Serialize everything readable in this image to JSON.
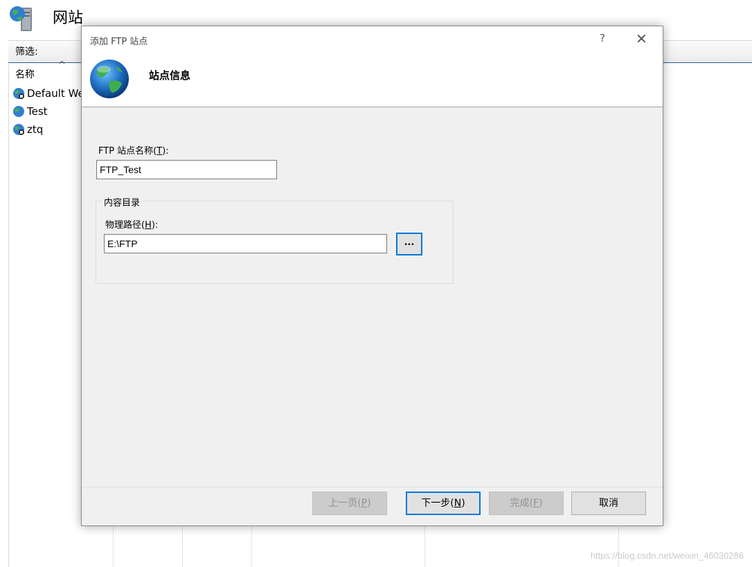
{
  "background": {
    "title": "网站",
    "filter_label": "筛选:",
    "column_name": "名称",
    "sites": [
      {
        "name": "Default We"
      },
      {
        "name": "Test"
      },
      {
        "name": "ztq"
      }
    ],
    "watermark": "https://blog.csdn.net/weixin_46030286"
  },
  "dialog": {
    "title": "添加 FTP 站点",
    "help_glyph": "?",
    "close_glyph": "✕",
    "banner_title": "站点信息",
    "site_name_label": "FTP 站点名称(",
    "site_name_accel": "T",
    "site_name_tail": "):",
    "site_name_value": "FTP_Test",
    "content_dir_group": "内容目录",
    "physical_path_label": "物理路径(",
    "physical_path_accel": "H",
    "physical_path_tail": "):",
    "physical_path_value": "E:\\FTP",
    "browse_label": "...",
    "buttons": {
      "prev": {
        "text": "上一页(",
        "accel": "P",
        "tail": ")"
      },
      "next": {
        "text": "下一步(",
        "accel": "N",
        "tail": ")"
      },
      "finish": {
        "text": "完成(",
        "accel": "F",
        "tail": ")"
      },
      "cancel": "取消"
    }
  },
  "colors": {
    "accent": "#0078d7",
    "dialog_bg": "#f0f0f0"
  },
  "icons": {
    "server": "server-globe-icon",
    "site": "globe-icon",
    "banner": "globe-icon"
  }
}
